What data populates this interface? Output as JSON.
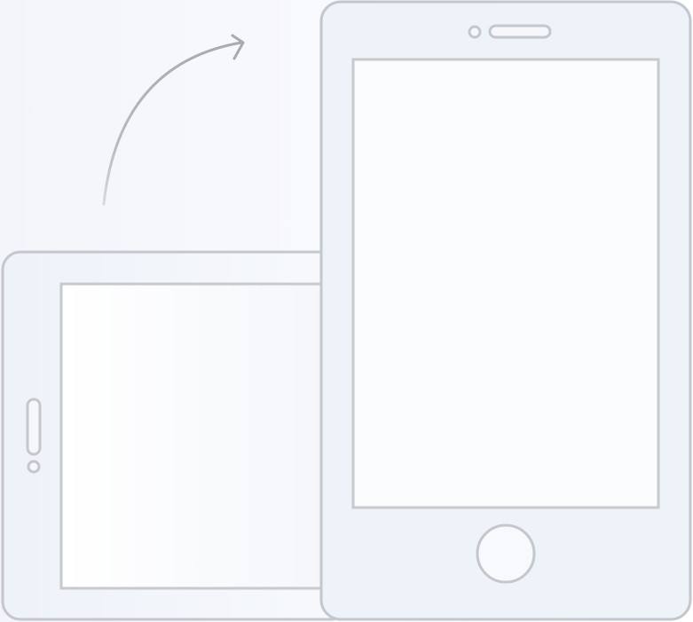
{
  "illustration": {
    "subject": "rotate-device",
    "devices": [
      {
        "orientation": "landscape"
      },
      {
        "orientation": "portrait"
      }
    ],
    "arrow_direction": "clockwise"
  },
  "colors": {
    "device_body_fill": "#eef2f9",
    "device_outline": "#c4c7cd",
    "screen_fill": "#fbfcfe",
    "screen_outline": "#c7c9cd",
    "arrow_stroke": "#b8b9bc",
    "background_left": "#f3f5fa",
    "background_right": "#ffffff"
  }
}
